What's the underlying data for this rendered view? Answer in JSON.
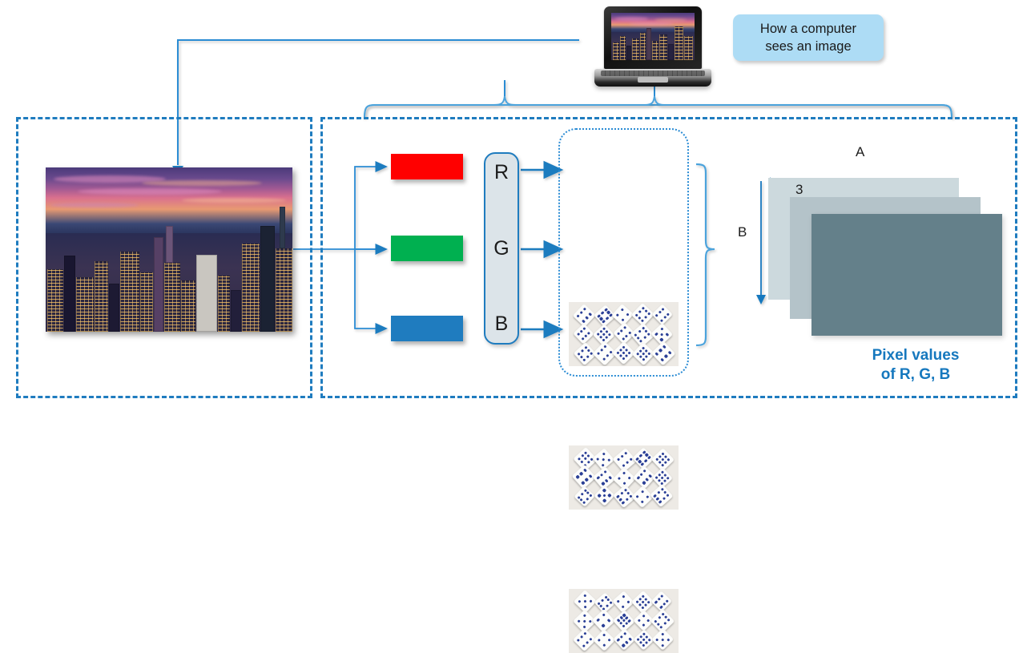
{
  "diagram": {
    "title": "How a computer sees an image",
    "accent_color": "#1F7CBF",
    "callout": {
      "line1": "How a computer",
      "line2": "sees an image",
      "fill": "#ADDCF5"
    },
    "source_image": {
      "name": "city-skyline-photo",
      "description": "Aerial photo of a city skyline at sunset"
    },
    "channels": [
      {
        "key": "R",
        "label": "R",
        "name": "red",
        "color": "#FF0000"
      },
      {
        "key": "G",
        "label": "G",
        "name": "green",
        "color": "#00B050"
      },
      {
        "key": "B",
        "label": "B",
        "name": "blue",
        "color": "#1F7CBF"
      }
    ],
    "pixel_grids": [
      {
        "channel": "R",
        "rows": 3,
        "cols": 5,
        "content": "dice"
      },
      {
        "channel": "G",
        "rows": 3,
        "cols": 5,
        "content": "dice"
      },
      {
        "channel": "B",
        "rows": 3,
        "cols": 5,
        "content": "dice"
      }
    ],
    "tensor": {
      "width_label": "A",
      "height_label": "B",
      "depth_label": "3",
      "layers": [
        {
          "name": "layer-back",
          "color": "#CCD9DD"
        },
        {
          "name": "layer-middle",
          "color": "#B4C3C9"
        },
        {
          "name": "layer-front",
          "color": "#64808A"
        }
      ],
      "caption_line1": "Pixel values",
      "caption_line2": "of R, G, B",
      "caption_color": "#1678BE"
    },
    "device": {
      "name": "laptop",
      "label": "laptop-computer"
    }
  }
}
